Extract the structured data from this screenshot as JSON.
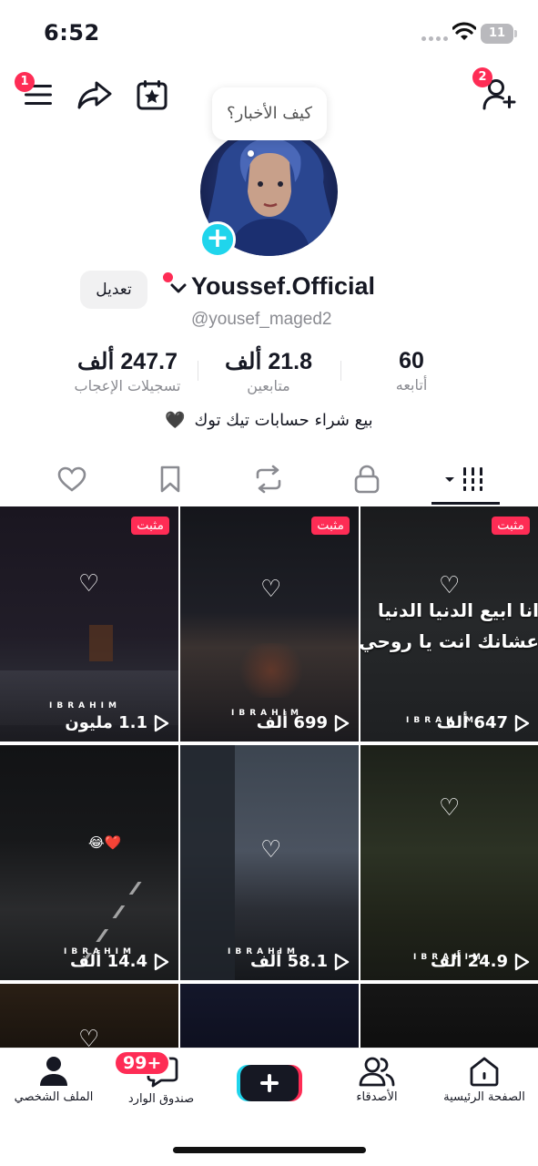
{
  "status_bar": {
    "time": "6:52",
    "battery": "11"
  },
  "header": {
    "menu_badge": "1",
    "add_friend_badge": "2"
  },
  "profile": {
    "bubble_text": "كيف الأخبار؟",
    "edit_label": "تعديل",
    "display_name": "Youssef.Official",
    "username": "@yousef_maged2",
    "bio": "بيع شراء حسابات تيك توك",
    "bio_emoji": "🖤"
  },
  "stats": {
    "following": {
      "value": "60",
      "label": "أتابعه"
    },
    "followers": {
      "value": "21.8 ألف",
      "label": "متابعين"
    },
    "likes": {
      "value": "247.7 ألف",
      "label": "تسجيلات الإعجاب"
    }
  },
  "videos": [
    {
      "views": "1.1 مليون",
      "pinned_label": "مثبت",
      "watermark": "IBRAHIM",
      "overlay": ""
    },
    {
      "views": "699 ألف",
      "pinned_label": "مثبت",
      "watermark": "IBRAHIM",
      "overlay": ""
    },
    {
      "views": "647 ألف",
      "pinned_label": "مثبت",
      "watermark": "IBRAHIM",
      "overlay": "انا ابيع الدنيا الدنيا",
      "overlay2": "عشانك انت يا روحي في ثانية"
    },
    {
      "views": "14.4 ألف",
      "pinned_label": "",
      "watermark": "IBRAHIM",
      "overlay": "😂❤️"
    },
    {
      "views": "58.1 ألف",
      "pinned_label": "",
      "watermark": "IBRAHIM",
      "overlay": ""
    },
    {
      "views": "24.9 ألف",
      "pinned_label": "",
      "watermark": "IBRAHIM",
      "overlay": ""
    }
  ],
  "bottom_nav": {
    "home": "الصفحة الرئيسية",
    "friends": "الأصدقاء",
    "inbox": "صندوق الوارد",
    "inbox_badge": "99+",
    "profile": "الملف الشخصي"
  }
}
